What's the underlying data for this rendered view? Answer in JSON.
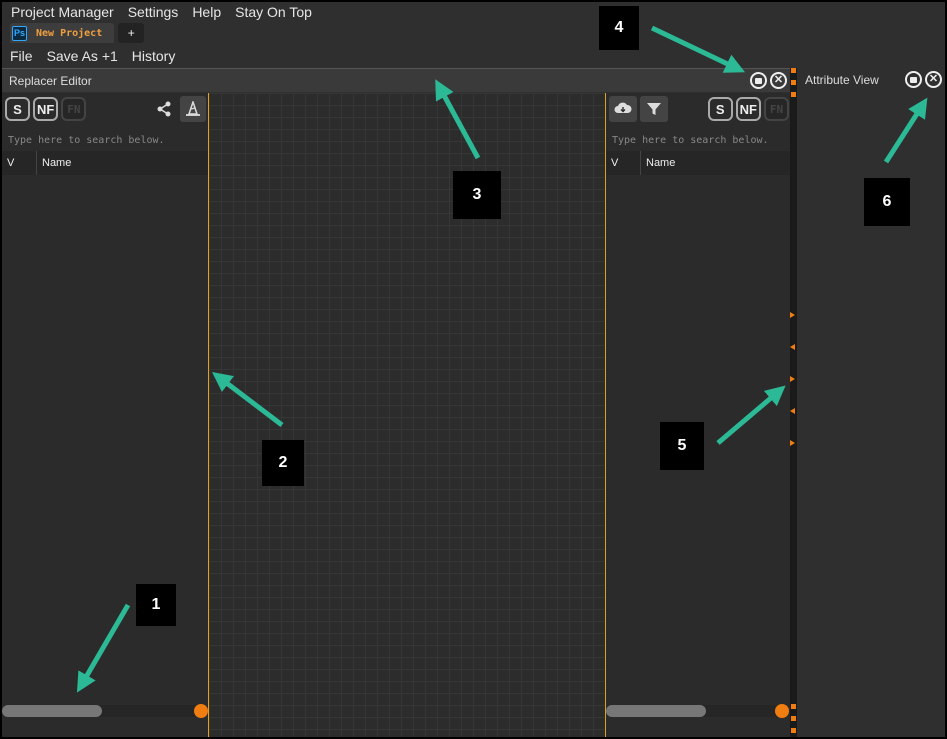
{
  "menubar": {
    "items": [
      "Project Manager",
      "Settings",
      "Help",
      "Stay On Top"
    ]
  },
  "tabs": {
    "project_badge": "Ps",
    "project_name": "New Project",
    "add_label": "+"
  },
  "menu2": {
    "items": [
      "File",
      "Save As +1",
      "History"
    ]
  },
  "replacer": {
    "title": "Replacer Editor"
  },
  "attribute": {
    "title": "Attribute View"
  },
  "left_panel": {
    "buttons": [
      "S",
      "NF",
      "FN"
    ],
    "search_placeholder": "Type here to search below.",
    "columns": [
      "V",
      "Name"
    ],
    "icons": [
      "share-icon",
      "wizard-hat-icon"
    ]
  },
  "right_panel": {
    "buttons": [
      "S",
      "NF",
      "FN"
    ],
    "search_placeholder": "Type here to search below.",
    "columns": [
      "V",
      "Name"
    ],
    "icons": [
      "cloud-download-icon",
      "filter-icon"
    ]
  },
  "colors": {
    "accent": "#f07d10",
    "callout_bg": "#000000",
    "arrow": "#2bb996",
    "canvas_border": "#e0a020"
  },
  "callouts": [
    "1",
    "2",
    "3",
    "4",
    "5",
    "6"
  ]
}
